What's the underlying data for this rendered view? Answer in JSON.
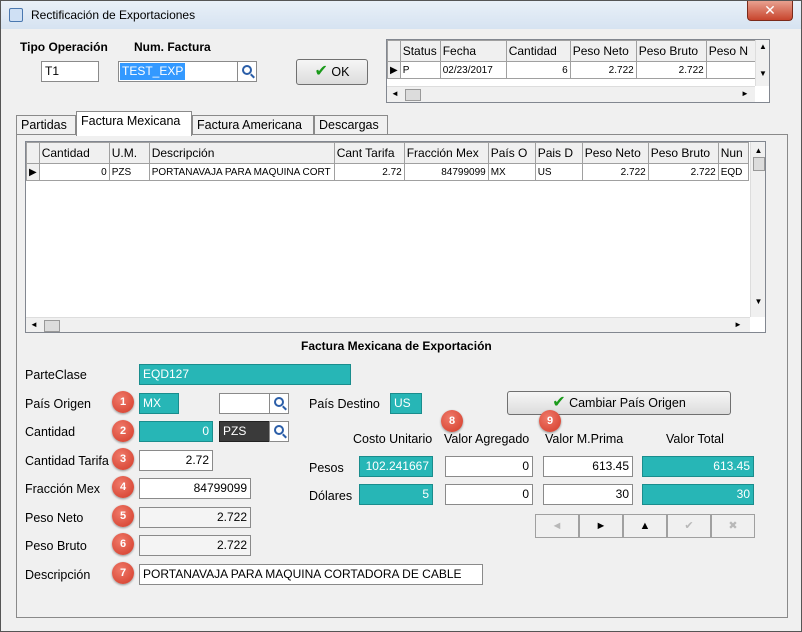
{
  "window": {
    "title": "Rectificación de Exportaciones",
    "close_glyph": "✕"
  },
  "header": {
    "tipo_operacion_label": "Tipo Operación",
    "num_factura_label": "Num. Factura",
    "tipo_operacion_value": "T1",
    "num_factura_value": "TEST_EXP",
    "ok_label": "OK"
  },
  "status_grid": {
    "columns": [
      "Status",
      "Fecha",
      "Cantidad",
      "Peso Neto",
      "Peso Bruto",
      "Peso N"
    ],
    "row": [
      "P",
      "02/23/2017",
      "6",
      "2.722",
      "2.722",
      ""
    ]
  },
  "tabs": [
    "Partidas",
    "Factura Mexicana",
    "Factura Americana",
    "Descargas"
  ],
  "items_grid": {
    "columns": [
      "Cantidad",
      "U.M.",
      "Descripción",
      "Cant Tarifa",
      "Fracción Mex",
      "País O",
      "Pais D",
      "Peso Neto",
      "Peso Bruto",
      "Nun"
    ],
    "row": [
      "0",
      "PZS",
      "PORTANAVAJA PARA MAQUINA CORT",
      "2.72",
      "84799099",
      "MX",
      "US",
      "2.722",
      "2.722",
      "EQD"
    ]
  },
  "section_title": "Factura Mexicana de Exportación",
  "form": {
    "parteclase_label": "ParteClase",
    "parteclase_value": "EQD127",
    "pais_origen_label": "País Origen",
    "pais_origen_value": "MX",
    "pais_origen_search_value": "",
    "pais_destino_label": "País Destino",
    "pais_destino_value": "US",
    "cambiar_label": "Cambiar País Origen",
    "cantidad_label": "Cantidad",
    "cantidad_value": "0",
    "um_value": "PZS",
    "cantidad_tarifa_label": "Cantidad Tarifa",
    "cantidad_tarifa_value": "2.72",
    "fraccion_label": "Fracción Mex",
    "fraccion_value": "84799099",
    "peso_neto_label": "Peso Neto",
    "peso_neto_value": "2.722",
    "peso_bruto_label": "Peso Bruto",
    "peso_bruto_value": "2.722",
    "descripcion_label": "Descripción",
    "descripcion_value": "PORTANAVAJA PARA MAQUINA CORTADORA DE CABLE"
  },
  "values_table": {
    "col_headers": [
      "Costo Unitario",
      "Valor Agregado",
      "Valor M.Prima",
      "Valor Total"
    ],
    "pesos_label": "Pesos",
    "dolares_label": "Dólares",
    "pesos": [
      "102.241667",
      "0",
      "613.45",
      "613.45"
    ],
    "dolares": [
      "5",
      "0",
      "30",
      "30"
    ]
  },
  "badges": [
    "1",
    "2",
    "3",
    "4",
    "5",
    "6",
    "7",
    "8",
    "9"
  ],
  "nav_buttons": [
    {
      "glyph": "◄",
      "icon": "first-icon"
    },
    {
      "glyph": "►",
      "icon": "next-icon"
    },
    {
      "glyph": "▲",
      "icon": "up-icon"
    },
    {
      "glyph": "✔",
      "icon": "confirm-icon"
    },
    {
      "glyph": "✖",
      "icon": "cancel-icon"
    }
  ],
  "colors": {
    "teal": "#27b6b6",
    "selection": "#3399ff",
    "badge": "#d23a28"
  }
}
